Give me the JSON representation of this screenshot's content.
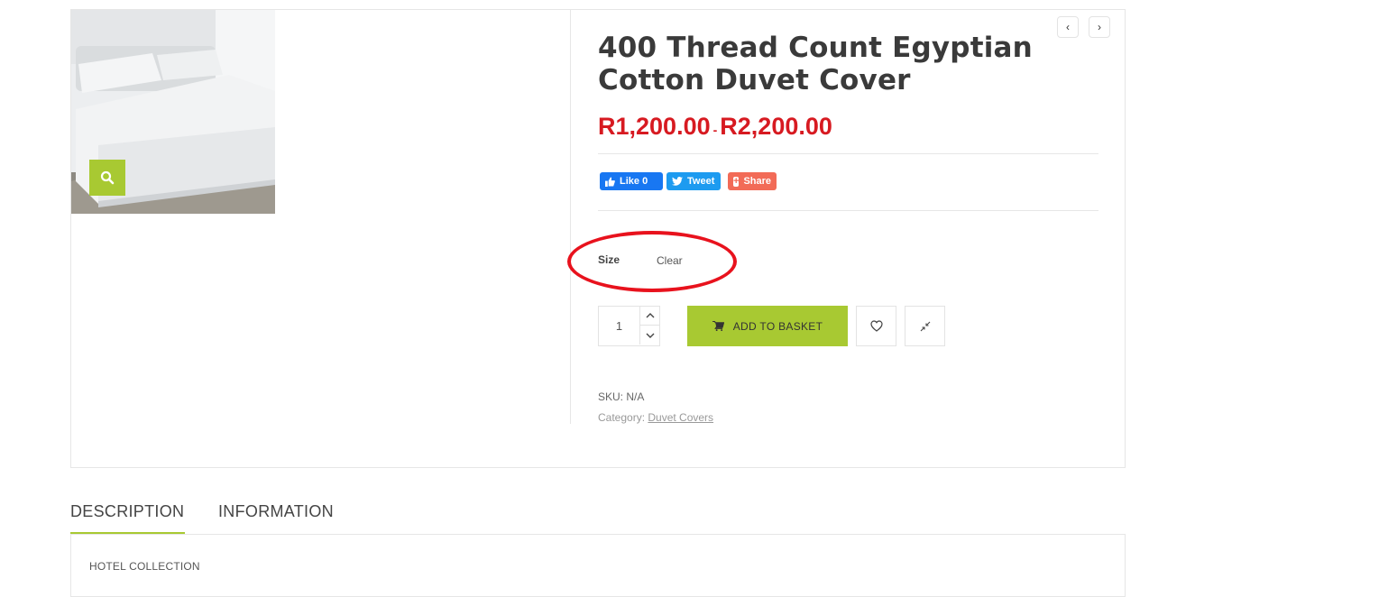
{
  "product": {
    "title": "400 Thread Count Egyptian Cotton Duvet Cover",
    "price_min": "R1,200.00",
    "price_separator": "-",
    "price_max": "R2,200.00"
  },
  "nav": {
    "prev_icon": "chevron-left-icon",
    "next_icon": "chevron-right-icon",
    "prev_glyph": "‹",
    "next_glyph": "›"
  },
  "social": {
    "like_label": "Like 0",
    "tweet_label": "Tweet",
    "share_label": "Share",
    "share_glyph": "+"
  },
  "variations": {
    "size_label": "Size",
    "clear_label": "Clear"
  },
  "cart": {
    "quantity": "1",
    "add_label": "ADD TO BASKET"
  },
  "meta": {
    "sku_text": "SKU: N/A",
    "category_prefix": "Category: ",
    "category_link": "Duvet Covers"
  },
  "tabs": [
    {
      "label": "DESCRIPTION"
    },
    {
      "label": "INFORMATION"
    }
  ],
  "description": {
    "text": "HOTEL COLLECTION"
  },
  "colors": {
    "accent": "#a8c932",
    "price": "#d71a21",
    "annotation": "#e8121d",
    "facebook": "#1877f2",
    "twitter": "#1d9bf0",
    "share": "#f26b57"
  }
}
